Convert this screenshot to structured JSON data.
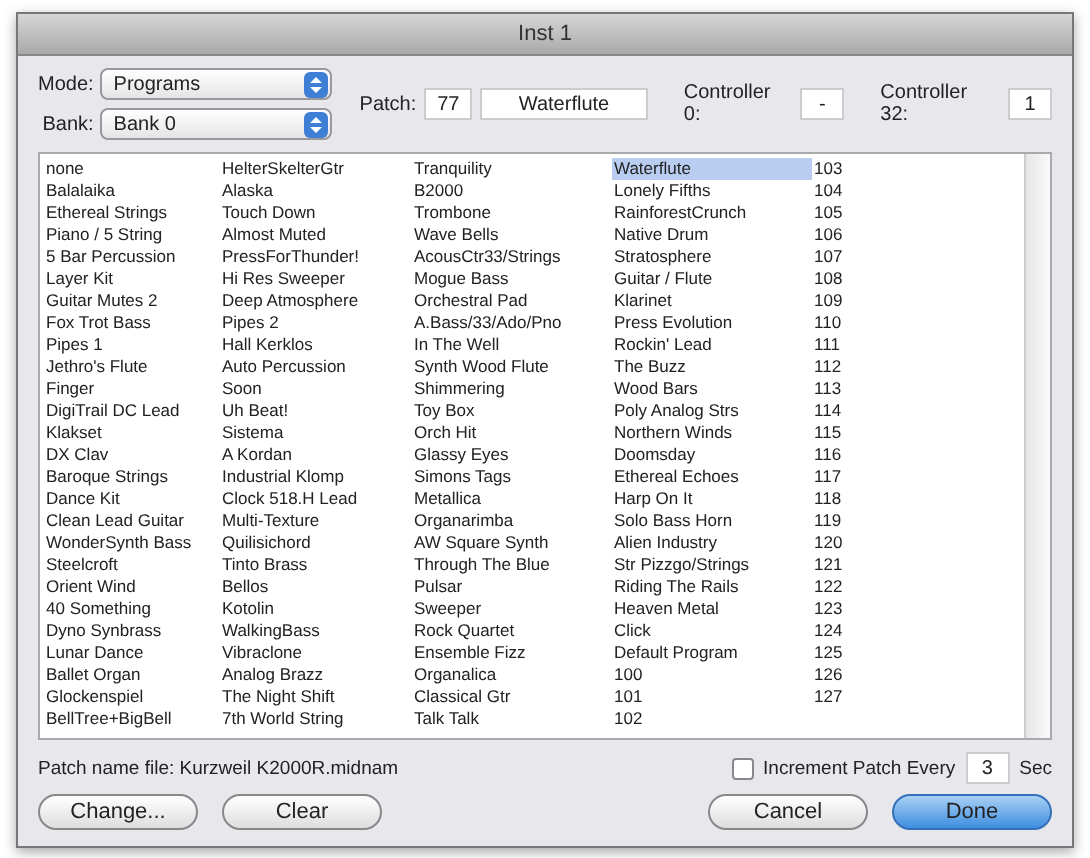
{
  "window": {
    "title": "Inst 1"
  },
  "mode": {
    "label": "Mode:",
    "value": "Programs"
  },
  "bank": {
    "label": "Bank:",
    "value": "Bank 0"
  },
  "patch": {
    "label": "Patch:",
    "number": "77",
    "name": "Waterflute"
  },
  "controller_0": {
    "label": "Controller 0:",
    "value": "-"
  },
  "controller_32": {
    "label": "Controller 32:",
    "value": "1"
  },
  "patch_list": {
    "columns": [
      [
        {
          "text": "none",
          "selected": false
        },
        {
          "text": "Balalaika",
          "selected": false
        },
        {
          "text": "Ethereal Strings",
          "selected": false
        },
        {
          "text": "Piano / 5 String",
          "selected": false
        },
        {
          "text": "5 Bar Percussion",
          "selected": false
        },
        {
          "text": "Layer Kit",
          "selected": false
        },
        {
          "text": "Guitar Mutes 2",
          "selected": false
        },
        {
          "text": "Fox Trot Bass",
          "selected": false
        },
        {
          "text": "Pipes 1",
          "selected": false
        },
        {
          "text": "Jethro's Flute",
          "selected": false
        },
        {
          "text": "Finger",
          "selected": false
        },
        {
          "text": "DigiTrail DC Lead",
          "selected": false
        },
        {
          "text": "Klakset",
          "selected": false
        },
        {
          "text": "DX Clav",
          "selected": false
        },
        {
          "text": "Baroque Strings",
          "selected": false
        },
        {
          "text": "Dance Kit",
          "selected": false
        },
        {
          "text": "Clean Lead Guitar",
          "selected": false
        },
        {
          "text": "WonderSynth Bass",
          "selected": false
        },
        {
          "text": "Steelcroft",
          "selected": false
        },
        {
          "text": "Orient Wind",
          "selected": false
        },
        {
          "text": "40 Something",
          "selected": false
        },
        {
          "text": "Dyno Synbrass",
          "selected": false
        },
        {
          "text": "Lunar Dance",
          "selected": false
        },
        {
          "text": "Ballet Organ",
          "selected": false
        },
        {
          "text": "Glockenspiel",
          "selected": false
        },
        {
          "text": "BellTree+BigBell",
          "selected": false
        }
      ],
      [
        {
          "text": "HelterSkelterGtr",
          "selected": false
        },
        {
          "text": "Alaska",
          "selected": false
        },
        {
          "text": "Touch Down",
          "selected": false
        },
        {
          "text": "Almost Muted",
          "selected": false
        },
        {
          "text": "PressForThunder!",
          "selected": false
        },
        {
          "text": "Hi Res Sweeper",
          "selected": false
        },
        {
          "text": "Deep Atmosphere",
          "selected": false
        },
        {
          "text": "Pipes 2",
          "selected": false
        },
        {
          "text": "Hall Kerklos",
          "selected": false
        },
        {
          "text": "Auto Percussion",
          "selected": false
        },
        {
          "text": "Soon",
          "selected": false
        },
        {
          "text": "Uh Beat!",
          "selected": false
        },
        {
          "text": "Sistema",
          "selected": false
        },
        {
          "text": "A Kordan",
          "selected": false
        },
        {
          "text": "Industrial Klomp",
          "selected": false
        },
        {
          "text": "Clock 518.H Lead",
          "selected": false
        },
        {
          "text": "Multi-Texture",
          "selected": false
        },
        {
          "text": "Quilisichord",
          "selected": false
        },
        {
          "text": "Tinto Brass",
          "selected": false
        },
        {
          "text": "Bellos",
          "selected": false
        },
        {
          "text": "Kotolin",
          "selected": false
        },
        {
          "text": "WalkingBass",
          "selected": false
        },
        {
          "text": "Vibraclone",
          "selected": false
        },
        {
          "text": "Analog Brazz",
          "selected": false
        },
        {
          "text": "The Night Shift",
          "selected": false
        },
        {
          "text": "7th World String",
          "selected": false
        }
      ],
      [
        {
          "text": "Tranquility",
          "selected": false
        },
        {
          "text": "B2000",
          "selected": false
        },
        {
          "text": "Trombone",
          "selected": false
        },
        {
          "text": "Wave Bells",
          "selected": false
        },
        {
          "text": "AcousCtr33/Strings",
          "selected": false
        },
        {
          "text": "Mogue Bass",
          "selected": false
        },
        {
          "text": "Orchestral Pad",
          "selected": false
        },
        {
          "text": "A.Bass/33/Ado/Pno",
          "selected": false
        },
        {
          "text": "In The Well",
          "selected": false
        },
        {
          "text": "Synth Wood Flute",
          "selected": false
        },
        {
          "text": "Shimmering",
          "selected": false
        },
        {
          "text": "Toy Box",
          "selected": false
        },
        {
          "text": "Orch Hit",
          "selected": false
        },
        {
          "text": "Glassy Eyes",
          "selected": false
        },
        {
          "text": "Simons Tags",
          "selected": false
        },
        {
          "text": "Metallica",
          "selected": false
        },
        {
          "text": "Organarimba",
          "selected": false
        },
        {
          "text": "AW Square Synth",
          "selected": false
        },
        {
          "text": "Through The Blue",
          "selected": false
        },
        {
          "text": "Pulsar",
          "selected": false
        },
        {
          "text": "Sweeper",
          "selected": false
        },
        {
          "text": "Rock Quartet",
          "selected": false
        },
        {
          "text": "Ensemble Fizz",
          "selected": false
        },
        {
          "text": "Organalica",
          "selected": false
        },
        {
          "text": "Classical Gtr",
          "selected": false
        },
        {
          "text": "Talk Talk",
          "selected": false
        }
      ],
      [
        {
          "text": "Waterflute",
          "selected": true
        },
        {
          "text": "Lonely Fifths",
          "selected": false
        },
        {
          "text": "RainforestCrunch",
          "selected": false
        },
        {
          "text": "Native Drum",
          "selected": false
        },
        {
          "text": "Stratosphere",
          "selected": false
        },
        {
          "text": "Guitar / Flute",
          "selected": false
        },
        {
          "text": "Klarinet",
          "selected": false
        },
        {
          "text": "Press Evolution",
          "selected": false
        },
        {
          "text": "Rockin' Lead",
          "selected": false
        },
        {
          "text": "The Buzz",
          "selected": false
        },
        {
          "text": "Wood Bars",
          "selected": false
        },
        {
          "text": "Poly Analog Strs",
          "selected": false
        },
        {
          "text": "Northern Winds",
          "selected": false
        },
        {
          "text": "Doomsday",
          "selected": false
        },
        {
          "text": "Ethereal Echoes",
          "selected": false
        },
        {
          "text": "Harp On It",
          "selected": false
        },
        {
          "text": "Solo Bass Horn",
          "selected": false
        },
        {
          "text": "Alien Industry",
          "selected": false
        },
        {
          "text": "Str Pizzgo/Strings",
          "selected": false
        },
        {
          "text": "Riding The Rails",
          "selected": false
        },
        {
          "text": "Heaven Metal",
          "selected": false
        },
        {
          "text": "Click",
          "selected": false
        },
        {
          "text": "Default Program",
          "selected": false
        },
        {
          "text": "100",
          "selected": false
        },
        {
          "text": "101",
          "selected": false
        },
        {
          "text": "102",
          "selected": false
        }
      ],
      [
        {
          "text": "103",
          "selected": false
        },
        {
          "text": "104",
          "selected": false
        },
        {
          "text": "105",
          "selected": false
        },
        {
          "text": "106",
          "selected": false
        },
        {
          "text": "107",
          "selected": false
        },
        {
          "text": "108",
          "selected": false
        },
        {
          "text": "109",
          "selected": false
        },
        {
          "text": "110",
          "selected": false
        },
        {
          "text": "111",
          "selected": false
        },
        {
          "text": "112",
          "selected": false
        },
        {
          "text": "113",
          "selected": false
        },
        {
          "text": "114",
          "selected": false
        },
        {
          "text": "115",
          "selected": false
        },
        {
          "text": "116",
          "selected": false
        },
        {
          "text": "117",
          "selected": false
        },
        {
          "text": "118",
          "selected": false
        },
        {
          "text": "119",
          "selected": false
        },
        {
          "text": "120",
          "selected": false
        },
        {
          "text": "121",
          "selected": false
        },
        {
          "text": "122",
          "selected": false
        },
        {
          "text": "123",
          "selected": false
        },
        {
          "text": "124",
          "selected": false
        },
        {
          "text": "125",
          "selected": false
        },
        {
          "text": "126",
          "selected": false
        },
        {
          "text": "127",
          "selected": false
        }
      ]
    ]
  },
  "patch_name_file": "Patch name file: Kurzweil K2000R.midnam",
  "increment": {
    "label": "Increment Patch Every",
    "checked": false,
    "value": "3",
    "unit": "Sec"
  },
  "buttons": [
    {
      "label": "Change...",
      "kind": "plain"
    },
    {
      "label": "Clear",
      "kind": "plain"
    },
    {
      "label": "Cancel",
      "kind": "plain"
    },
    {
      "label": "Done",
      "kind": "default"
    }
  ]
}
